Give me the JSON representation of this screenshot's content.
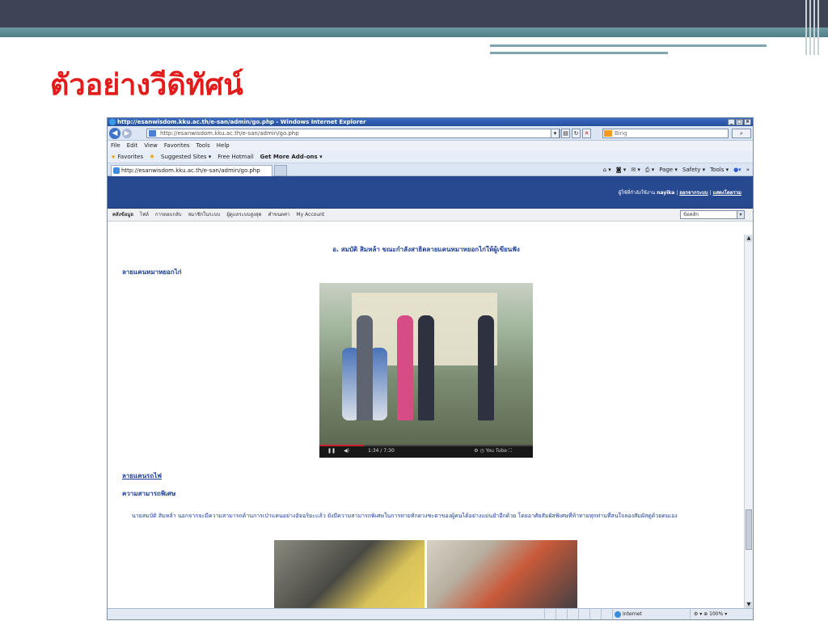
{
  "slide": {
    "title": "ตัวอย่างวีดิทัศน์"
  },
  "browser": {
    "window_title": "http://esanwisdom.kku.ac.th/e-san/admin/go.php - Windows Internet Explorer",
    "address": "http://esanwisdom.kku.ac.th/e-san/admin/go.php",
    "search_placeholder": "Bing",
    "menu": [
      "File",
      "Edit",
      "View",
      "Favorites",
      "Tools",
      "Help"
    ],
    "favorites": {
      "favorites_label": "Favorites",
      "suggested": "Suggested Sites ▾",
      "hotmail": "Free Hotmail",
      "addons": "Get More Add-ons ▾"
    },
    "tab_title": "http://esanwisdom.kku.ac.th/e-san/admin/go.php",
    "commands": [
      "Page ▾",
      "Safety ▾",
      "Tools ▾"
    ],
    "status_zone": "Internet",
    "status_zoom": "100%"
  },
  "site": {
    "user_prefix": "ผู้ใช้ที่กำลังใช้งาน",
    "username": "nayika",
    "logout_link": "ออกจากระบบ",
    "show_all_link": "แสดงโดยรวม",
    "nav": [
      "คลังข้อมูล",
      "ไฟล์",
      "การตอบกลับ",
      "สมาชิกในระบบ",
      "ผู้ดูแลระบบสูงสุด",
      "คำขนดค่า",
      "My Account"
    ],
    "select_value": "ข้อคลัก"
  },
  "content": {
    "caption": "อ. สมบัติ สิมหล้า ขณะกำลังสาธิตลายแคนหมาหยอกไก่ให้ผู้เขียนฟัง",
    "section1": "ลายแคนหมาหยอกไก่",
    "video_time": "1:34 / 7:30",
    "video_progress": 0.21,
    "section2": "ลายแคนรถไฟ",
    "section3": "ความสามารถพิเศษ",
    "paragraph": "นายสมบัติ สิมหล้า นอกจากจะมีความสามารถด้านการเป่าแคนอย่างอัจฉริยะแล้ว ยังมีความสามารถพิเศษในการทายทักดวงชะตาของผู้คนได้อย่างแม่นยำอีกด้วย โดยอาศัยสัมผัสพิเศษที่ท้าทายทุกท่านที่สนใจลองสัมผัสดูด้วยตนเอง"
  }
}
